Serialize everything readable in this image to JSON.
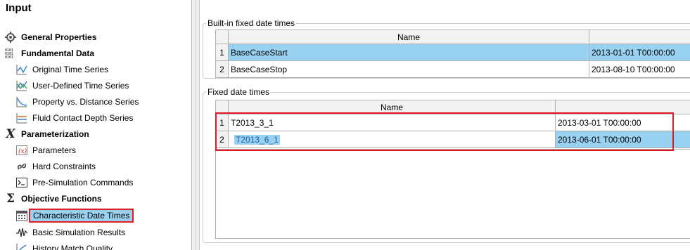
{
  "nav": {
    "title": "Input",
    "items": [
      {
        "label": "General Properties",
        "icon": "gear-icon"
      },
      {
        "label": "Fundamental Data",
        "icon": "binary-data-icon"
      },
      {
        "label": "Original Time Series",
        "icon": "line-chart-icon"
      },
      {
        "label": "User-Defined Time Series",
        "icon": "multi-line-chart-icon"
      },
      {
        "label": "Property vs. Distance Series",
        "icon": "curve-chart-icon"
      },
      {
        "label": "Fluid Contact Depth Series",
        "icon": "depth-series-icon"
      },
      {
        "label": "Parameterization",
        "icon": "variable-x-icon"
      },
      {
        "label": "Parameters",
        "icon": "parameter-x-icon"
      },
      {
        "label": "Hard Constraints",
        "icon": "constraint-link-icon"
      },
      {
        "label": "Pre-Simulation Commands",
        "icon": "command-prompt-icon"
      },
      {
        "label": "Objective Functions",
        "icon": "sigma-icon"
      },
      {
        "label": "Characteristic Date Times",
        "icon": "calendar-icon"
      },
      {
        "label": "Basic Simulation Results",
        "icon": "waveform-icon"
      },
      {
        "label": "History Match Quality",
        "icon": "quality-icon"
      }
    ]
  },
  "builtin": {
    "legend": "Built-in fixed date times",
    "column_name": "Name",
    "rows": [
      {
        "num": "1",
        "name": "BaseCaseStart",
        "datetime": "2013-01-01 T00:00:00"
      },
      {
        "num": "2",
        "name": "BaseCaseStop",
        "datetime": "2013-08-10 T00:00:00"
      }
    ]
  },
  "fixed": {
    "legend": "Fixed date times",
    "column_name": "Name",
    "rows": [
      {
        "num": "1",
        "name": "T2013_3_1",
        "datetime": "2013-03-01 T00:00:00"
      },
      {
        "num": "2",
        "name": "T2013_6_1",
        "datetime": "2013-06-01 T00:00:00"
      }
    ]
  },
  "colors": {
    "selection": "#99d1f1",
    "highlight_border": "#e01b24"
  }
}
